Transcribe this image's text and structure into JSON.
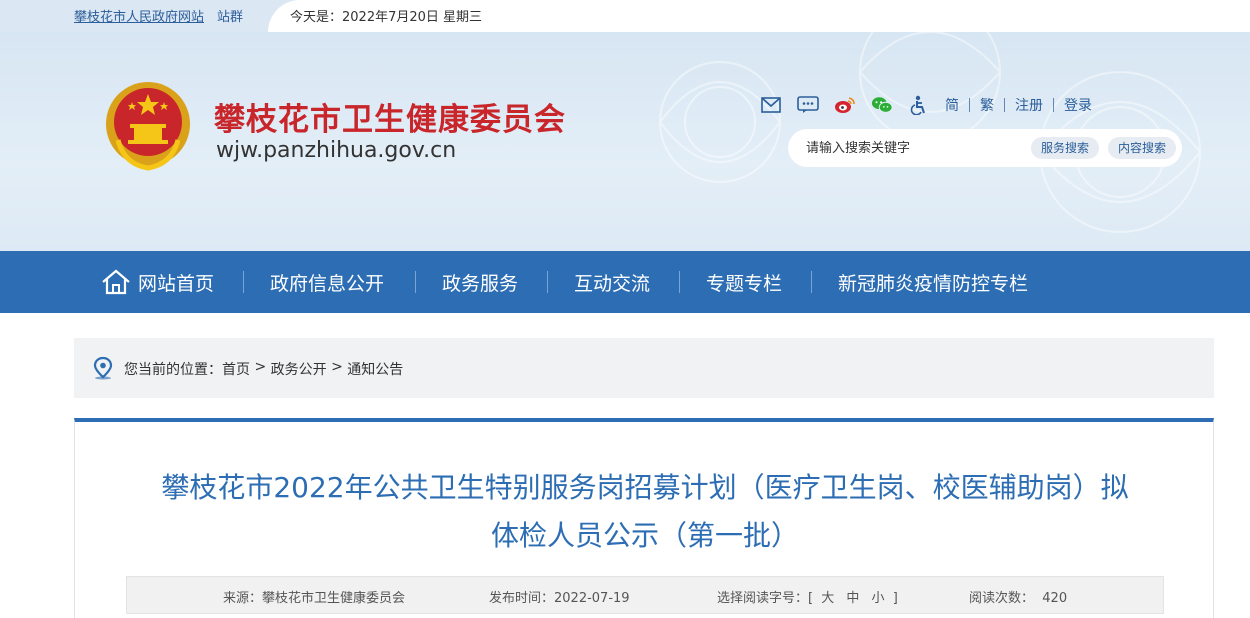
{
  "topbar": {
    "site_link": "攀枝花市人民政府网站",
    "site_group": "站群",
    "today": "今天是：2022年7月20日 星期三"
  },
  "header": {
    "title": "攀枝花市卫生健康委员会",
    "domain": "wjw.panzhihua.gov.cn",
    "icons": [
      "mail-icon",
      "message-icon",
      "weibo-icon",
      "wechat-icon",
      "accessibility-icon"
    ],
    "links": {
      "simplified": "简",
      "traditional": "繁",
      "register": "注册",
      "login": "登录"
    },
    "search": {
      "placeholder": "请输入搜索关键字",
      "service_button": "服务搜索",
      "content_button": "内容搜索"
    }
  },
  "nav": {
    "items": [
      "网站首页",
      "政府信息公开",
      "政务服务",
      "互动交流",
      "专题专栏",
      "新冠肺炎疫情防控专栏"
    ]
  },
  "breadcrumb": {
    "label": "您当前的位置：",
    "items": [
      "首页",
      "政务公开",
      "通知公告"
    ],
    "separator": " > "
  },
  "article": {
    "title_line1": "攀枝花市2022年公共卫生特别服务岗招募计划（医疗卫生岗、校医辅助岗）拟",
    "title_line2": "体检人员公示（第一批）",
    "meta": {
      "source_label": "来源：",
      "source": "攀枝花市卫生健康委员会",
      "date_label": "发布时间：",
      "date": "2022-07-19",
      "font_label": "选择阅读字号：",
      "font_open": "[",
      "font_large": "大",
      "font_medium": "中",
      "font_small": "小",
      "font_close": "]",
      "views_label": "阅读次数：",
      "views": "420"
    }
  },
  "colors": {
    "primary_blue": "#2c6db3",
    "title_red": "#c8262a",
    "header_bg": "#d7e6f3"
  }
}
